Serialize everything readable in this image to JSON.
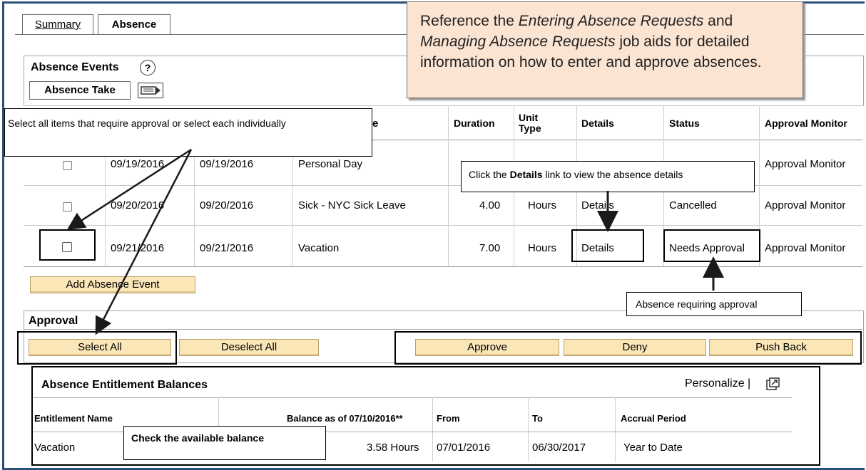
{
  "tabs": [
    {
      "label": "Summary"
    },
    {
      "label": "Absence"
    }
  ],
  "absence_events": {
    "title": "Absence Events",
    "help": "?",
    "subtab": "Absence Take"
  },
  "table": {
    "headers": {
      "duration": "Duration",
      "unit_type": "Unit Type",
      "details": "Details",
      "status": "Status",
      "approval_monitor": "Approval Monitor",
      "partial": "e"
    },
    "rows": [
      {
        "start": "09/19/2016",
        "end": "09/19/2016",
        "name": "Personal Day",
        "duration": "",
        "unit": "",
        "details": "",
        "status": "",
        "monitor": "Approval Monitor"
      },
      {
        "start": "09/20/2016",
        "end": "09/20/2016",
        "name": "Sick - NYC Sick Leave",
        "duration": "4.00",
        "unit": "Hours",
        "details": "Details",
        "status": "Cancelled",
        "monitor": "Approval Monitor"
      },
      {
        "start": "09/21/2016",
        "end": "09/21/2016",
        "name": "Vacation",
        "duration": "7.00",
        "unit": "Hours",
        "details": "Details",
        "status": "Needs Approval",
        "monitor": "Approval Monitor"
      }
    ]
  },
  "buttons": {
    "add_absence": "Add Absence Event",
    "select_all": "Select All",
    "deselect_all": "Deselect All",
    "approve": "Approve",
    "deny": "Deny",
    "push_back": "Push Back"
  },
  "approval": {
    "title": "Approval"
  },
  "balances": {
    "title": "Absence Entitlement Balances",
    "personalize": "Personalize |",
    "headers": {
      "name": "Entitlement Name",
      "balance": "Balance as of 07/10/2016**",
      "from": "From",
      "to": "To",
      "accrual": "Accrual Period"
    },
    "row": {
      "name": "Vacation",
      "balance": "3.58 Hours",
      "from": "07/01/2016",
      "to": "06/30/2017",
      "accrual": "Year to Date"
    }
  },
  "callouts": {
    "select": "Select all items that require approval or select each individually",
    "details_pre": "Click the ",
    "details_bold": "Details",
    "details_post": " link to view the absence details",
    "approval": "Absence requiring approval",
    "balance": "Check the available balance"
  },
  "note": {
    "p1": "Reference the ",
    "i1": "Entering Absence Requests",
    "p2": " and ",
    "i2": "Managing Absence Requests",
    "p3": " job aids for detailed information on how to enter and approve absences."
  },
  "icons": {
    "help": "help-icon",
    "grid": "grid-view-icon",
    "popout": "new-window-icon"
  }
}
